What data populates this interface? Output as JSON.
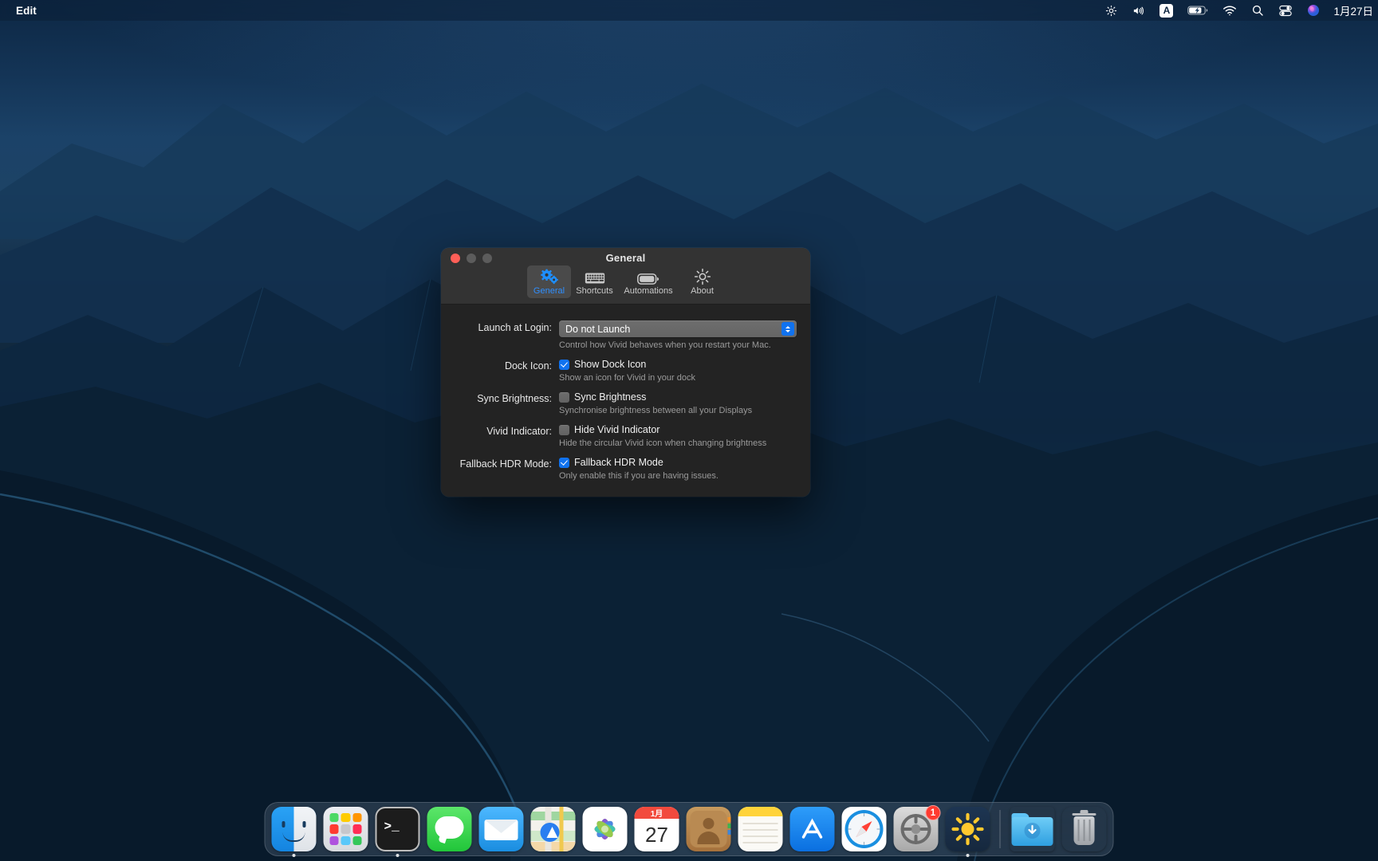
{
  "menubar": {
    "app_menu": "Edit",
    "status_icons": [
      {
        "name": "brightness-icon",
        "glyph": "brightness"
      },
      {
        "name": "volume-icon",
        "glyph": "volume"
      },
      {
        "name": "input-source-icon",
        "glyph": "A"
      },
      {
        "name": "battery-charging-icon",
        "glyph": "battery"
      },
      {
        "name": "wifi-icon",
        "glyph": "wifi"
      },
      {
        "name": "spotlight-search-icon",
        "glyph": "search"
      },
      {
        "name": "control-center-icon",
        "glyph": "controlcenter"
      },
      {
        "name": "siri-icon",
        "glyph": "siri"
      }
    ],
    "clock": "1月27日"
  },
  "window": {
    "title": "General",
    "traffic_lights": [
      "close",
      "minimize",
      "zoom"
    ],
    "toolbar": [
      {
        "label": "General",
        "icon": "gears-icon",
        "selected": true
      },
      {
        "label": "Shortcuts",
        "icon": "keyboard-icon",
        "selected": false
      },
      {
        "label": "Automations",
        "icon": "battery-icon",
        "selected": false
      },
      {
        "label": "About",
        "icon": "sun-icon",
        "selected": false
      }
    ],
    "form": [
      {
        "id": "launch-at-login",
        "label": "Launch at Login:",
        "control": "popup",
        "value": "Do not Launch",
        "options": [
          "Do not Launch"
        ],
        "description": "Control how Vivid behaves when you restart your Mac."
      },
      {
        "id": "dock-icon",
        "label": "Dock Icon:",
        "control": "checkbox",
        "checkbox_label": "Show Dock Icon",
        "checked": true,
        "description": "Show an icon for Vivid in your dock"
      },
      {
        "id": "sync-brightness",
        "label": "Sync Brightness:",
        "control": "checkbox",
        "checkbox_label": "Sync Brightness",
        "checked": false,
        "description": "Synchronise brightness between all your Displays"
      },
      {
        "id": "vivid-indicator",
        "label": "Vivid Indicator:",
        "control": "checkbox",
        "checkbox_label": "Hide Vivid Indicator",
        "checked": false,
        "description": "Hide the circular Vivid icon when changing brightness"
      },
      {
        "id": "fallback-hdr-mode",
        "label": "Fallback HDR Mode:",
        "control": "checkbox",
        "checkbox_label": "Fallback HDR Mode",
        "checked": true,
        "description": "Only enable this if you are having issues."
      }
    ]
  },
  "dock": {
    "items": [
      {
        "name": "finder",
        "label": "Finder",
        "running": true
      },
      {
        "name": "launchpad",
        "label": "Launchpad",
        "running": false
      },
      {
        "name": "terminal",
        "label": "Terminal",
        "running": true
      },
      {
        "name": "messages",
        "label": "Messages",
        "running": false
      },
      {
        "name": "mail",
        "label": "Mail",
        "running": false
      },
      {
        "name": "maps",
        "label": "Maps",
        "running": false
      },
      {
        "name": "photos",
        "label": "Photos",
        "running": false
      },
      {
        "name": "calendar",
        "label": "Calendar",
        "running": false,
        "month": "1月",
        "day": "27"
      },
      {
        "name": "contacts",
        "label": "Contacts",
        "running": false
      },
      {
        "name": "notes",
        "label": "Notes",
        "running": false
      },
      {
        "name": "app-store",
        "label": "App Store",
        "running": false
      },
      {
        "name": "safari",
        "label": "Safari",
        "running": false
      },
      {
        "name": "system-preferences",
        "label": "System Preferences",
        "running": false,
        "badge": "1"
      },
      {
        "name": "vivid",
        "label": "Vivid",
        "running": true
      },
      {
        "name": "downloads-folder",
        "label": "Downloads",
        "running": false
      },
      {
        "name": "trash",
        "label": "Trash",
        "running": false
      }
    ]
  },
  "colors": {
    "accent_blue": "#1072ef",
    "selected_tab_blue": "#2f8fff",
    "window_bg": "#232323",
    "titlebar_bg": "#333333",
    "badge_red": "#ff3b30"
  }
}
